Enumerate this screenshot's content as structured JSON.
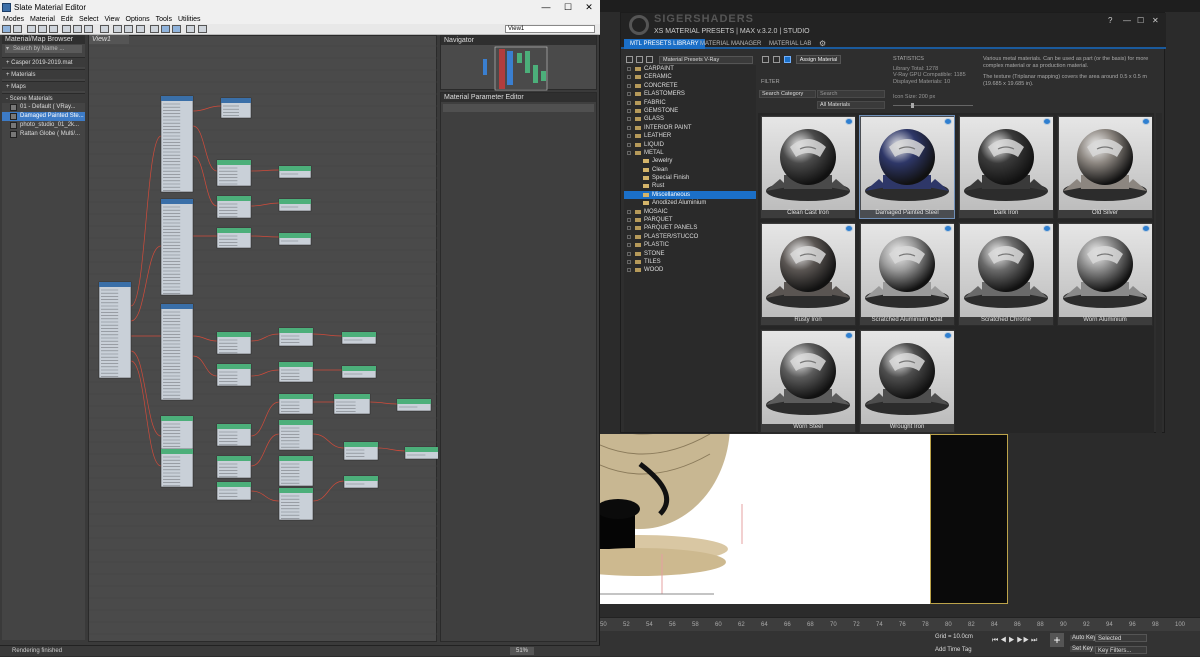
{
  "slate": {
    "title": "Slate Material Editor",
    "menu": [
      "Modes",
      "Material",
      "Edit",
      "Select",
      "View",
      "Options",
      "Tools",
      "Utilities"
    ],
    "view_dropdown": "View1",
    "browser_title": "Material/Map Browser",
    "search_placeholder": "Search by Name ...",
    "sections": {
      "library": "+ Casper 2019-2019.mat",
      "materials": "+ Materials",
      "maps": "+ Maps",
      "scene": "- Scene Materials"
    },
    "scene_items": [
      "01 - Default  ( VRay...",
      "Damaged Painted Ste...",
      "photo_studio_01_2k...",
      "Rattan Globe  ( Multi/..."
    ],
    "view_tab": "View1",
    "navigator_title": "Navigator",
    "param_editor_title": "Material Parameter Editor",
    "status": "Rendering finished",
    "zoom": "51%"
  },
  "xs": {
    "brand": "SIGERSHADERS",
    "subtitle": "XS MATERIAL PRESETS | MAX v.3.2.0 | STUDIO",
    "tabs": [
      "MTL PRESETS LIBRARY",
      "MATERIAL MANAGER",
      "MATERIAL LAB"
    ],
    "preset_select": "Material Presets V-Ray",
    "assign_button": "Assign Material",
    "filter_label": "FILTER",
    "category_search": "Search Category",
    "search_placeholder": "Search",
    "all_materials": "All Materials",
    "stats": {
      "heading": "STATISTICS",
      "library_total": "Library Total: 1278",
      "gpu": "V-Ray GPU Compatible: 1185",
      "displayed": "Displayed Materials: 10"
    },
    "icon_size": "Icon Size: 200 px",
    "description_1": "Various metal materials. Can be used as part (or the basis) for more complex material or as production material.",
    "description_2": "The texture (Triplanar mapping) covers the area around 0.5 x 0.5 m (19.685 x 19.685 in).",
    "categories": [
      {
        "label": "CARPAINT",
        "level": 0,
        "selected": false
      },
      {
        "label": "CERAMIC",
        "level": 0,
        "selected": false
      },
      {
        "label": "CONCRETE",
        "level": 0,
        "selected": false
      },
      {
        "label": "ELASTOMERS",
        "level": 0,
        "selected": false
      },
      {
        "label": "FABRIC",
        "level": 0,
        "selected": false
      },
      {
        "label": "GEMSTONE",
        "level": 0,
        "selected": false
      },
      {
        "label": "GLASS",
        "level": 0,
        "selected": false
      },
      {
        "label": "INTERIOR PAINT",
        "level": 0,
        "selected": false
      },
      {
        "label": "LEATHER",
        "level": 0,
        "selected": false
      },
      {
        "label": "LIQUID",
        "level": 0,
        "selected": false
      },
      {
        "label": "METAL",
        "level": 0,
        "selected": false
      },
      {
        "label": "Jewelry",
        "level": 1,
        "selected": false
      },
      {
        "label": "Clean",
        "level": 1,
        "selected": false
      },
      {
        "label": "Special Finish",
        "level": 1,
        "selected": false
      },
      {
        "label": "Rust",
        "level": 1,
        "selected": false
      },
      {
        "label": "Miscellaneous",
        "level": 1,
        "selected": true
      },
      {
        "label": "Anodized Aluminium",
        "level": 1,
        "selected": false
      },
      {
        "label": "MOSAIC",
        "level": 0,
        "selected": false
      },
      {
        "label": "PARQUET",
        "level": 0,
        "selected": false
      },
      {
        "label": "PARQUET PANELS",
        "level": 0,
        "selected": false
      },
      {
        "label": "PLASTER/STUCCO",
        "level": 0,
        "selected": false
      },
      {
        "label": "PLASTIC",
        "level": 0,
        "selected": false
      },
      {
        "label": "STONE",
        "level": 0,
        "selected": false
      },
      {
        "label": "TILES",
        "level": 0,
        "selected": false
      },
      {
        "label": "WOOD",
        "level": 0,
        "selected": false
      }
    ],
    "materials": [
      {
        "name": "Clean Cast Iron",
        "tone": "#4a4a4a",
        "selected": false
      },
      {
        "name": "Damaged Painted Steel",
        "tone": "#2e3768",
        "selected": true
      },
      {
        "name": "Dark Iron",
        "tone": "#3a3a3a",
        "selected": false
      },
      {
        "name": "Old Silver",
        "tone": "#8c8680",
        "selected": false
      },
      {
        "name": "Rusty Iron",
        "tone": "#5a5552",
        "selected": false
      },
      {
        "name": "Scratched Aluminium Coat",
        "tone": "#9a9a9a",
        "selected": false
      },
      {
        "name": "Scratched Chrome",
        "tone": "#6a6a6a",
        "selected": false
      },
      {
        "name": "Worn Aluminium",
        "tone": "#8a8a8a",
        "selected": false
      },
      {
        "name": "Worn Steel",
        "tone": "#5c5c5c",
        "selected": false
      },
      {
        "name": "Wrought Iron",
        "tone": "#4e4e4e",
        "selected": false
      }
    ]
  },
  "viewport": {
    "timeline_ticks": [
      "50",
      "52",
      "54",
      "56",
      "58",
      "60",
      "62",
      "64",
      "66",
      "68",
      "70",
      "72",
      "74",
      "76",
      "78",
      "80",
      "82",
      "84",
      "86",
      "88",
      "90",
      "92",
      "94",
      "96",
      "98",
      "100"
    ],
    "grid": "Grid = 10.0cm",
    "add_time_tag": "Add Time Tag",
    "auto_key": "Auto Key",
    "selected": "Selected",
    "set_key": "Set Key",
    "key_filters": "Key Filters..."
  }
}
